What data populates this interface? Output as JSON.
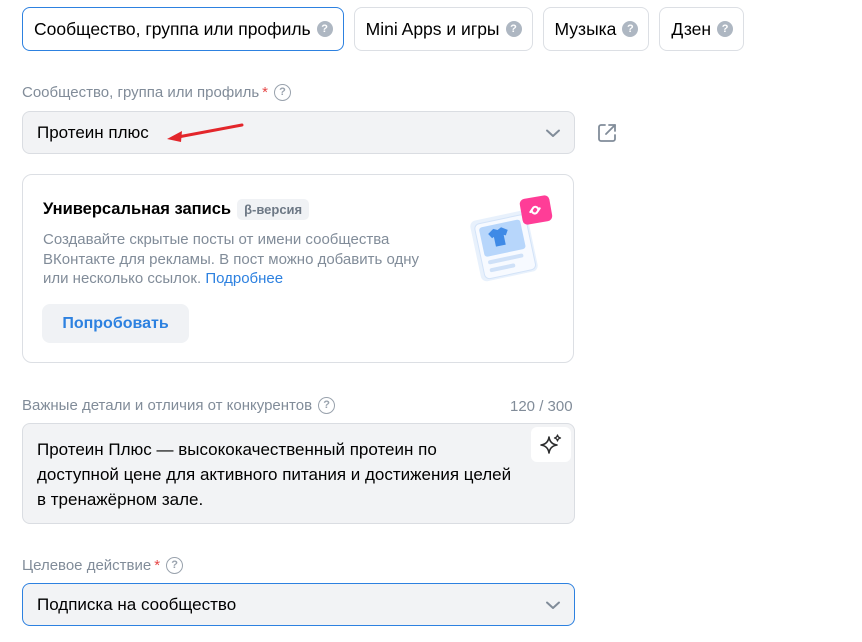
{
  "tabs": [
    {
      "label": "Сообщество, группа или профиль",
      "active": true
    },
    {
      "label": "Mini Apps и игры",
      "active": false
    },
    {
      "label": "Музыка",
      "active": false
    },
    {
      "label": "Дзен",
      "active": false
    }
  ],
  "community_field": {
    "label": "Сообщество, группа или профиль",
    "required_mark": "*",
    "value": "Протеин плюс"
  },
  "universal_card": {
    "title": "Универсальная запись",
    "badge": "β-версия",
    "description": "Создавайте скрытые посты от имени сообщества ВКонтакте для рекламы. В пост можно добавить одну или несколько ссылок.",
    "link_text": "Подробнее",
    "button_label": "Попробовать"
  },
  "details_field": {
    "label": "Важные детали и отличия от конкурентов",
    "counter": "120 / 300",
    "value": "Протеин Плюс — высококачественный протеин по доступной цене для активного питания и достижения целей в тренажёрном зале."
  },
  "target_field": {
    "label": "Целевое действие",
    "required_mark": "*",
    "value": "Подписка на сообщество"
  },
  "icons": {
    "help": "?"
  },
  "colors": {
    "accent": "#2d81e0",
    "required": "#e64646",
    "muted_text": "#818c99",
    "field_bg": "#f2f3f5",
    "annotation_arrow": "#e3262b"
  }
}
